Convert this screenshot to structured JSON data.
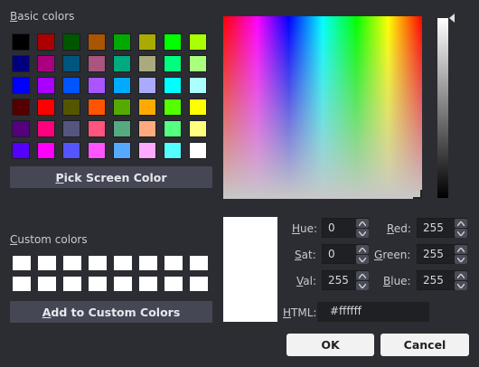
{
  "basic_colors": {
    "label_first": "B",
    "label_rest": "asic colors",
    "swatches": [
      "#000000",
      "#aa0000",
      "#005500",
      "#aa5500",
      "#00aa00",
      "#aaaa00",
      "#00ff00",
      "#aaff00",
      "#00007f",
      "#aa007f",
      "#00557f",
      "#aa557f",
      "#00aa7f",
      "#aaaa7f",
      "#00ff7f",
      "#aaff7f",
      "#0000ff",
      "#aa00ff",
      "#0055ff",
      "#aa55ff",
      "#00aaff",
      "#aaaaff",
      "#00ffff",
      "#aaffff",
      "#550000",
      "#ff0000",
      "#555500",
      "#ff5500",
      "#55aa00",
      "#ffaa00",
      "#55ff00",
      "#ffff00",
      "#55007f",
      "#ff007f",
      "#55557f",
      "#ff557f",
      "#55aa7f",
      "#ffaa7f",
      "#55ff7f",
      "#ffff7f",
      "#5500ff",
      "#ff00ff",
      "#5555ff",
      "#ff55ff",
      "#55aaff",
      "#ffaaff",
      "#55ffff",
      "#ffffff"
    ]
  },
  "pick_screen": {
    "u": "P",
    "rest": "ick Screen Color"
  },
  "custom_colors": {
    "label_first": "C",
    "label_rest": "ustom colors",
    "swatches": [
      "#ffffff",
      "#ffffff",
      "#ffffff",
      "#ffffff",
      "#ffffff",
      "#ffffff",
      "#ffffff",
      "#ffffff",
      "#ffffff",
      "#ffffff",
      "#ffffff",
      "#ffffff",
      "#ffffff",
      "#ffffff",
      "#ffffff",
      "#ffffff"
    ]
  },
  "add_custom": {
    "u": "A",
    "rest": "dd to Custom Colors"
  },
  "current_color": "#ffffff",
  "fields": {
    "hue": {
      "u": "H",
      "rest": "ue:",
      "value": "0"
    },
    "sat": {
      "u": "S",
      "rest": "at:",
      "value": "0"
    },
    "val": {
      "u": "V",
      "rest": "al:",
      "value": "255"
    },
    "red": {
      "u": "R",
      "rest": "ed:",
      "value": "255"
    },
    "green": {
      "u": "G",
      "rest": "reen:",
      "value": "255"
    },
    "blue": {
      "u": "B",
      "rest": "lue:",
      "value": "255"
    },
    "html": {
      "u": "H",
      "rest": "TML:",
      "value": "#ffffff"
    }
  },
  "buttons": {
    "ok": "OK",
    "cancel": "Cancel"
  }
}
